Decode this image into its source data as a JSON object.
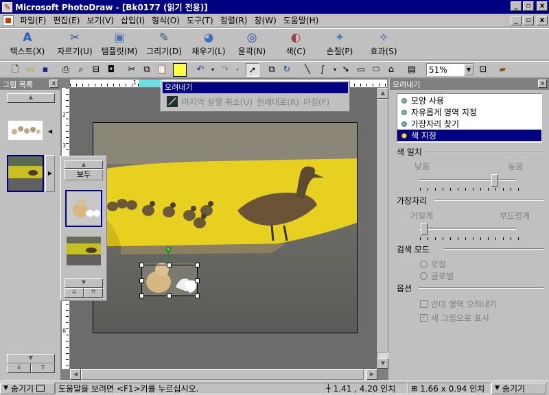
{
  "app": {
    "title": "Microsoft PhotoDraw - [Bk0177 (읽기 전용)]",
    "window_buttons": [
      "_",
      "▫",
      "x"
    ],
    "doc_buttons": [
      "_",
      "▫",
      "x"
    ]
  },
  "menu": [
    "파일(F)",
    "편집(E)",
    "보기(V)",
    "삽입(I)",
    "형식(O)",
    "도구(T)",
    "정렬(R)",
    "창(W)",
    "도움말(H)"
  ],
  "big_toolbar": [
    {
      "label": "텍스트(X)",
      "icon": "text-icon",
      "glyph": "A",
      "color": "#2060c0"
    },
    {
      "label": "자르기(U)",
      "icon": "scissors-icon",
      "glyph": "✂",
      "color": "#3050a0"
    },
    {
      "label": "템플릿(M)",
      "icon": "template-icon",
      "glyph": "🗂",
      "color": "#5070b0"
    },
    {
      "label": "그리기(D)",
      "icon": "pencil-icon",
      "glyph": "✎",
      "color": "#306060"
    },
    {
      "label": "채우기(L)",
      "icon": "fill-icon",
      "glyph": "◕",
      "color": "#4070c0"
    },
    {
      "label": "윤곽(N)",
      "icon": "outline-icon",
      "glyph": "◎",
      "color": "#2050b0"
    },
    {
      "label": "색(C)",
      "icon": "color-icon",
      "glyph": "◐",
      "color": "#a04040"
    },
    {
      "label": "손질(P)",
      "icon": "touchup-icon",
      "glyph": "✦",
      "color": "#4080c0"
    },
    {
      "label": "효과(S)",
      "icon": "effects-icon",
      "glyph": "✧",
      "color": "#3060a0"
    }
  ],
  "standard_toolbar": {
    "zoom_value": "51%"
  },
  "picture_list": {
    "title": "그림 목록",
    "close": "x"
  },
  "flyout": {
    "all_label": "보두"
  },
  "cut_menu": {
    "title": "오려내기",
    "items": [
      "마지막 실행 취소(U)",
      "원래대로(R)",
      "마침(F)"
    ]
  },
  "ruler": {
    "labels": [
      "1",
      "2",
      "3",
      "4",
      "5",
      "6",
      "7",
      "8"
    ]
  },
  "right_panel": {
    "title": "오려내기",
    "close": "x",
    "options": [
      "모양 사용",
      "자유롭게 영역 지정",
      "가장자리 찾기",
      "색 지정"
    ],
    "selected_index": 3,
    "color_match": {
      "label": "색 일치",
      "low": "낮음",
      "high": "높음",
      "value": 0.78
    },
    "edge": {
      "label": "가장자리",
      "rough": "거칠게",
      "smooth": "부드럽게",
      "value": 0.02
    },
    "search_mode": {
      "label": "검색 모드",
      "local": "로컬",
      "global": "글로벌"
    },
    "options_section": {
      "label": "옵션",
      "invert": "반대 영역 오려내기",
      "new_picture": "새 그림으로 표시",
      "new_picture_checked": true
    }
  },
  "status": {
    "hide_left": "숨기기",
    "help": "도움말을 보려면 <F1>키를 누르십시오.",
    "position": "1.41 , 4.20 인치",
    "size": "1.66 x 0.94 인치",
    "hide_right": "숨기기"
  }
}
